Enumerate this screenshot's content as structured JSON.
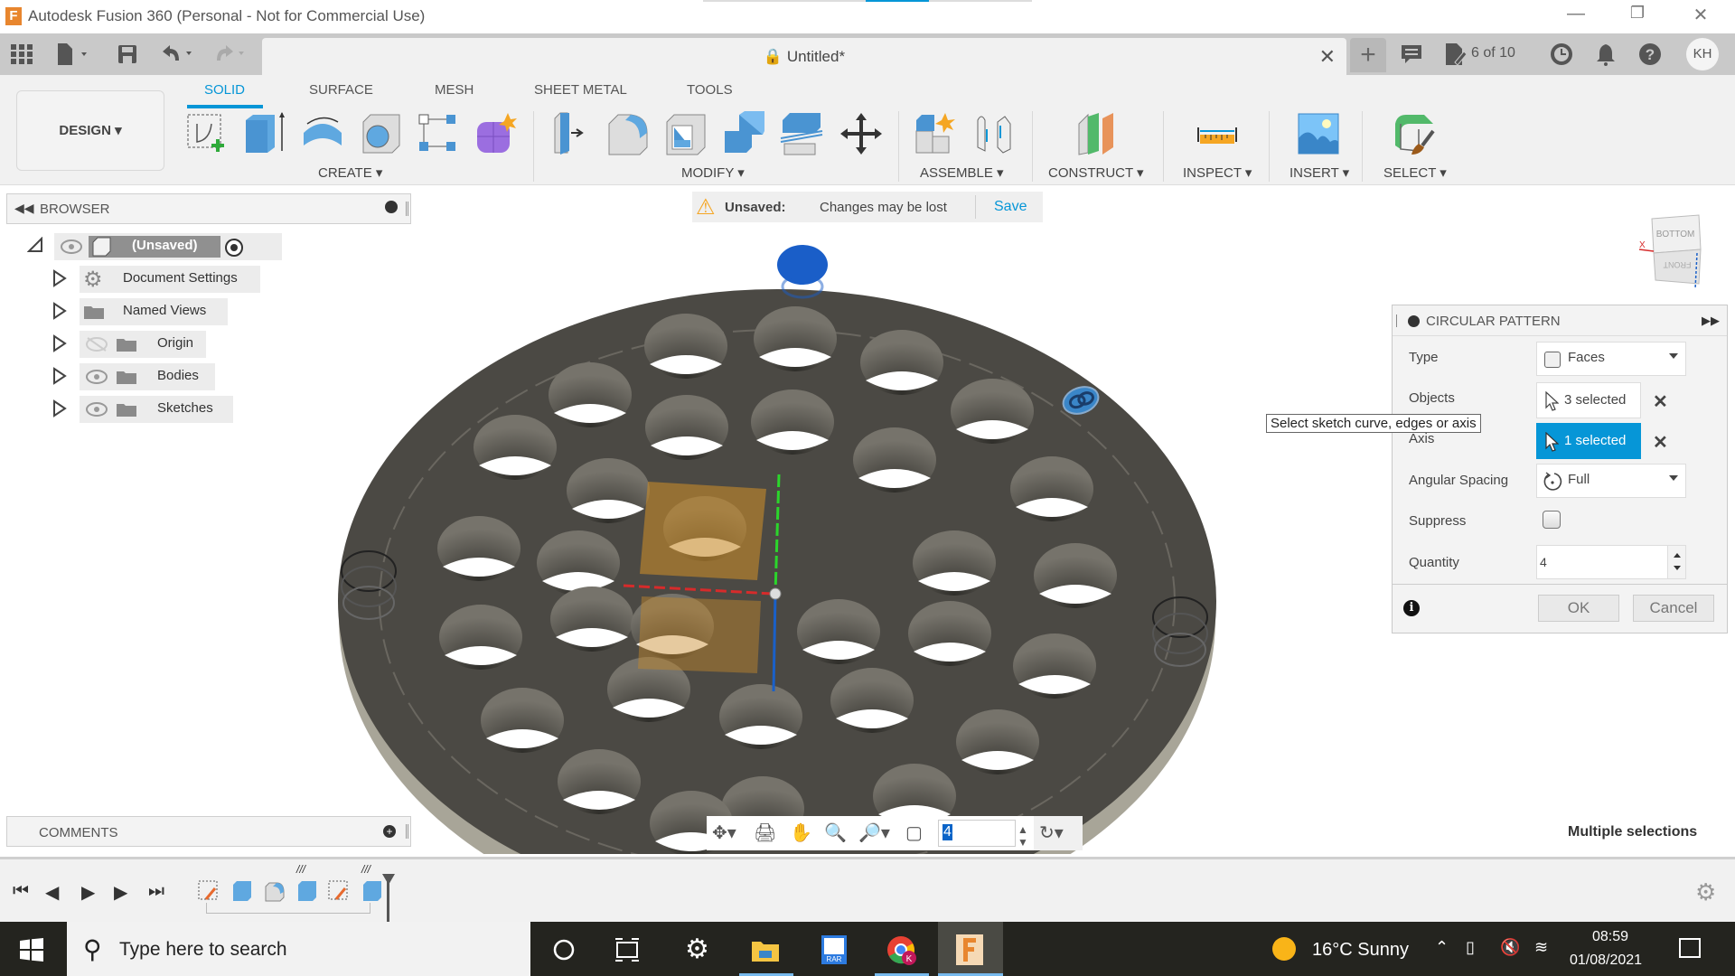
{
  "window": {
    "app_icon": "fusion-360-logo",
    "title": "Autodesk Fusion 360 (Personal - Not for Commercial Use)",
    "controls": [
      "minimize",
      "restore",
      "close"
    ]
  },
  "tabbar": {
    "quick_access": [
      "data-panel-grid-icon",
      "file-icon",
      "save-icon",
      "undo-icon",
      "redo-icon"
    ],
    "document_tab": "Untitled*",
    "jobs": "6 of 10",
    "user_initials": "KH"
  },
  "ribbon": {
    "workspace": "DESIGN",
    "tabs": [
      {
        "label": "SOLID",
        "active": true
      },
      {
        "label": "SURFACE",
        "active": false
      },
      {
        "label": "MESH",
        "active": false
      },
      {
        "label": "SHEET METAL",
        "active": false
      },
      {
        "label": "TOOLS",
        "active": false
      }
    ],
    "groups": [
      {
        "label": "CREATE",
        "tools": [
          "create-sketch",
          "extrude",
          "revolve",
          "hole",
          "pattern",
          "create-form"
        ]
      },
      {
        "label": "MODIFY",
        "tools": [
          "press-pull",
          "fillet",
          "shell",
          "combine",
          "offset-face",
          "move-copy"
        ]
      },
      {
        "label": "ASSEMBLE",
        "tools": [
          "new-component",
          "joint"
        ]
      },
      {
        "label": "CONSTRUCT",
        "tools": [
          "offset-plane"
        ]
      },
      {
        "label": "INSPECT",
        "tools": [
          "measure"
        ]
      },
      {
        "label": "INSERT",
        "tools": [
          "insert-canvas"
        ]
      },
      {
        "label": "SELECT",
        "tools": [
          "select"
        ]
      }
    ]
  },
  "unsaved_bar": {
    "title": "Unsaved:",
    "message": "Changes may be lost",
    "action": "Save"
  },
  "browser": {
    "title": "BROWSER",
    "root": "(Unsaved)",
    "items": [
      {
        "label": "Document Settings",
        "icon": "gear"
      },
      {
        "label": "Named Views",
        "icon": "folder"
      },
      {
        "label": "Origin",
        "icon": "folder",
        "hidden": true
      },
      {
        "label": "Bodies",
        "icon": "folder"
      },
      {
        "label": "Sketches",
        "icon": "folder"
      }
    ]
  },
  "viewcube": {
    "top": "BOTTOM",
    "front": "FRONT",
    "axis": "X"
  },
  "circular_pattern": {
    "title": "CIRCULAR PATTERN",
    "type_label": "Type",
    "type_value": "Faces",
    "objects_label": "Objects",
    "objects_value": "3 selected",
    "axis_label": "Axis",
    "axis_value": "1 selected",
    "angular_label": "Angular Spacing",
    "angular_value": "Full",
    "suppress_label": "Suppress",
    "suppress_checked": false,
    "quantity_label": "Quantity",
    "quantity_value": "4",
    "ok": "OK",
    "cancel": "Cancel"
  },
  "tooltip": "Select sketch curve, edges or axis",
  "comments": {
    "title": "COMMENTS"
  },
  "status": {
    "selection": "Multiple selections"
  },
  "navbar": {
    "input_value": "4"
  },
  "timeline": {
    "controls": [
      "go-to-start",
      "step-back",
      "play",
      "step-forward",
      "go-to-end"
    ],
    "features": [
      "sketch",
      "extrude",
      "fillet",
      "extrude-pattern",
      "sketch",
      "extrude-pattern"
    ]
  },
  "taskbar": {
    "search_placeholder": "Type here to search",
    "weather": "16°C  Sunny",
    "time": "08:59",
    "date": "01/08/2021"
  }
}
